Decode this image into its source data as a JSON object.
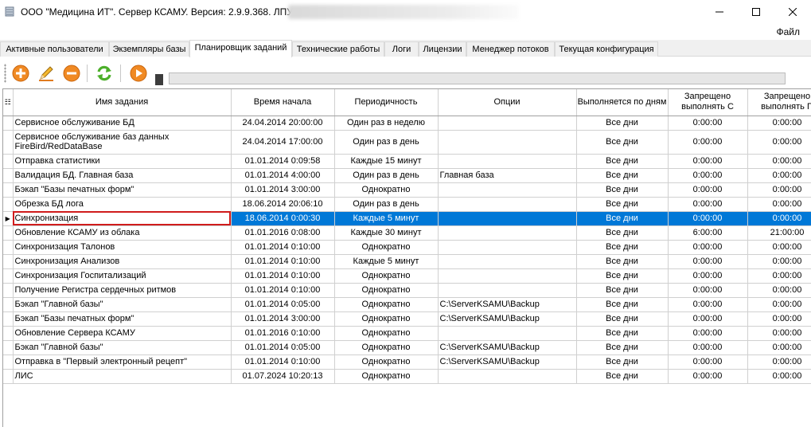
{
  "window": {
    "title": "ООО \"Медицина ИТ\". Сервер КСАМУ. Версия: 2.9.9.368. ЛПУ:",
    "icons": {
      "app": "server-app-icon",
      "minimize": "minimize-icon",
      "maximize": "maximize-icon",
      "close": "close-icon"
    }
  },
  "menu": {
    "file": "Файл"
  },
  "tabs": [
    {
      "label": "Активные пользователи"
    },
    {
      "label": "Экземпляры базы"
    },
    {
      "label": "Планировщик заданий",
      "active": true
    },
    {
      "label": "Технические работы"
    },
    {
      "label": "Логи"
    },
    {
      "label": "Лицензии"
    },
    {
      "label": "Менеджер потоков"
    },
    {
      "label": "Текущая конфигурация"
    }
  ],
  "toolbar": {
    "buttons": [
      "add-icon",
      "edit-pencil-icon",
      "remove-icon",
      "refresh-icon",
      "run-play-icon"
    ],
    "colors": {
      "orange": "#f08a24",
      "green": "#4caf2a"
    }
  },
  "grid": {
    "columns": [
      "Имя задания",
      "Время начала",
      "Периодичность",
      "Опции",
      "Выполняется по дням",
      "Запрещено выполнять С",
      "Запрещено выполнять П"
    ],
    "selected_index": 6,
    "rows": [
      {
        "name": "Сервисное обслуживание БД",
        "start": "24.04.2014 20:00:00",
        "period": "Один раз в неделю",
        "options": "",
        "days": "Все дни",
        "from": "0:00:00",
        "to": "0:00:00"
      },
      {
        "name": "Сервисное обслуживание баз данных FireBird/RedDataBase",
        "start": "24.04.2014 17:00:00",
        "period": "Один раз в день",
        "options": "",
        "days": "Все дни",
        "from": "0:00:00",
        "to": "0:00:00"
      },
      {
        "name": "Отправка статистики",
        "start": "01.01.2014 0:09:58",
        "period": "Каждые 15 минут",
        "options": "",
        "days": "Все дни",
        "from": "0:00:00",
        "to": "0:00:00"
      },
      {
        "name": "Валидация БД. Главная база",
        "start": "01.01.2014 4:00:00",
        "period": "Один раз в день",
        "options": "Главная база",
        "days": "Все дни",
        "from": "0:00:00",
        "to": "0:00:00"
      },
      {
        "name": "Бэкап \"Базы печатных форм\"",
        "start": "01.01.2014 3:00:00",
        "period": "Однократно",
        "options": "",
        "days": "Все дни",
        "from": "0:00:00",
        "to": "0:00:00"
      },
      {
        "name": "Обрезка БД лога",
        "start": "18.06.2014 20:06:10",
        "period": "Один раз в день",
        "options": "",
        "days": "Все дни",
        "from": "0:00:00",
        "to": "0:00:00"
      },
      {
        "name": "Синхронизация",
        "start": "18.06.2014 0:00:30",
        "period": "Каждые 5 минут",
        "options": "",
        "days": "Все дни",
        "from": "0:00:00",
        "to": "0:00:00"
      },
      {
        "name": "Обновление КСАМУ из облака",
        "start": "01.01.2016 0:08:00",
        "period": "Каждые 30 минут",
        "options": "",
        "days": "Все дни",
        "from": "6:00:00",
        "to": "21:00:00"
      },
      {
        "name": "Синхронизация Талонов",
        "start": "01.01.2014 0:10:00",
        "period": "Однократно",
        "options": "",
        "days": "Все дни",
        "from": "0:00:00",
        "to": "0:00:00"
      },
      {
        "name": "Синхронизация Анализов",
        "start": "01.01.2014 0:10:00",
        "period": "Каждые 5 минут",
        "options": "",
        "days": "Все дни",
        "from": "0:00:00",
        "to": "0:00:00"
      },
      {
        "name": "Синхронизация Госпитализаций",
        "start": "01.01.2014 0:10:00",
        "period": "Однократно",
        "options": "",
        "days": "Все дни",
        "from": "0:00:00",
        "to": "0:00:00"
      },
      {
        "name": "Получение Регистра сердечных ритмов",
        "start": "01.01.2014 0:10:00",
        "period": "Однократно",
        "options": "",
        "days": "Все дни",
        "from": "0:00:00",
        "to": "0:00:00"
      },
      {
        "name": "Бэкап \"Главной базы\"",
        "start": "01.01.2014 0:05:00",
        "period": "Однократно",
        "options": "C:\\ServerKSAMU\\Backup",
        "days": "Все дни",
        "from": "0:00:00",
        "to": "0:00:00"
      },
      {
        "name": "Бэкап \"Базы печатных форм\"",
        "start": "01.01.2014 3:00:00",
        "period": "Однократно",
        "options": "C:\\ServerKSAMU\\Backup",
        "days": "Все дни",
        "from": "0:00:00",
        "to": "0:00:00"
      },
      {
        "name": "Обновление Сервера КСАМУ",
        "start": "01.01.2016 0:10:00",
        "period": "Однократно",
        "options": "",
        "days": "Все дни",
        "from": "0:00:00",
        "to": "0:00:00"
      },
      {
        "name": "Бэкап \"Главной базы\"",
        "start": "01.01.2014 0:05:00",
        "period": "Однократно",
        "options": "C:\\ServerKSAMU\\Backup",
        "days": "Все дни",
        "from": "0:00:00",
        "to": "0:00:00"
      },
      {
        "name": "Отправка в \"Первый электронный рецепт\"",
        "start": "01.01.2014 0:10:00",
        "period": "Однократно",
        "options": "C:\\ServerKSAMU\\Backup",
        "days": "Все дни",
        "from": "0:00:00",
        "to": "0:00:00"
      },
      {
        "name": "ЛИС",
        "start": "01.07.2024 10:20:13",
        "period": "Однократно",
        "options": "",
        "days": "Все дни",
        "from": "0:00:00",
        "to": "0:00:00"
      }
    ]
  }
}
